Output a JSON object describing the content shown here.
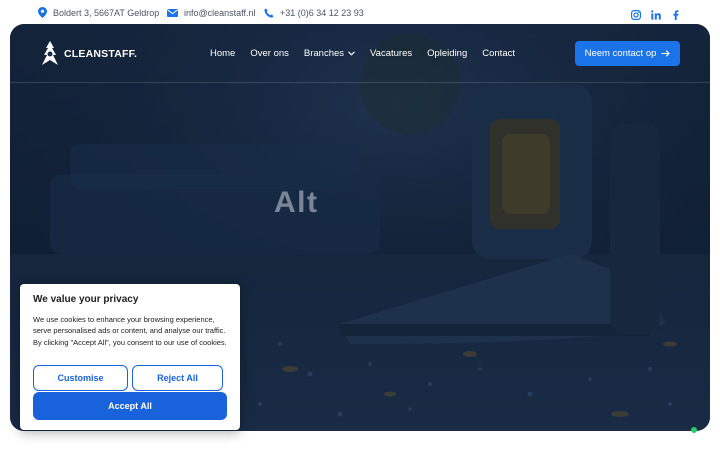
{
  "topbar": {
    "address": "Boldert 3, 5667AT Geldrop",
    "email": "info@cleanstaff.nl",
    "phone": "+31 (0)6 34 12 23 93",
    "icons": [
      "location-pin-icon",
      "envelope-icon",
      "phone-icon"
    ],
    "social": [
      "instagram-icon",
      "linkedin-icon",
      "facebook-icon"
    ]
  },
  "header": {
    "logo_text": "CLEANSTAFF.",
    "nav": [
      "Home",
      "Over ons",
      "Branches",
      "Vacatures",
      "Opleiding",
      "Contact"
    ],
    "cta_label": "Neem contact op"
  },
  "hero": {
    "alt_text": "Alt"
  },
  "cookie": {
    "title": "We value your privacy",
    "body": "We use cookies to enhance your browsing experience, serve personalised ads or content, and analyse our traffic. By clicking \"Accept All\", you consent to our use of cookies.",
    "customise": "Customise",
    "reject": "Reject All",
    "accept": "Accept All"
  },
  "colors": {
    "brand_blue": "#1a73e8",
    "cookie_blue": "#1863dc",
    "topbar_icon": "#1a73e8",
    "status_dot": "#2ecc71"
  }
}
